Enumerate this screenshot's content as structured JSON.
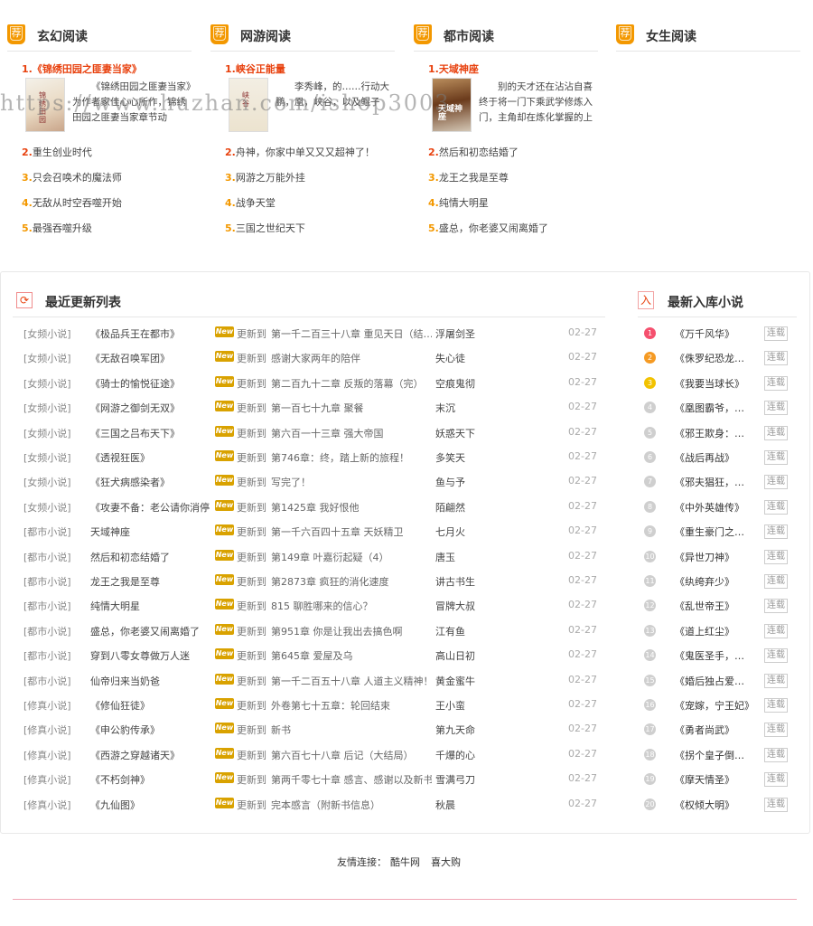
{
  "watermark": "https://www.huzhan.com/ishop3003",
  "categories": [
    {
      "title": "玄幻阅读",
      "badge": "荐",
      "top": {
        "rank": "1.",
        "title": "《锦绣田园之匪妻当家》",
        "cover_text": "锦绣田园",
        "desc": "《锦绣田园之匪妻当家》为作者家佳心心所作，锦绣田园之匪妻当家章节动"
      },
      "items": [
        {
          "rank": "2.",
          "title": "重生创业时代"
        },
        {
          "rank": "3.",
          "title": "只会召唤术的魔法师"
        },
        {
          "rank": "4.",
          "title": "无敌从时空吞噬开始"
        },
        {
          "rank": "5.",
          "title": "最强吞噬升级"
        }
      ]
    },
    {
      "title": "网游阅读",
      "badge": "荐",
      "top": {
        "rank": "1.",
        "title": "峡谷正能量",
        "cover_text": "峡谷",
        "desc": "李秀峰，的……行动大鹏，凰，峡谷，以及鲲子"
      },
      "items": [
        {
          "rank": "2.",
          "title": "舟神，你家中单又又又超神了！"
        },
        {
          "rank": "3.",
          "title": "网游之万能外挂"
        },
        {
          "rank": "4.",
          "title": "战争天堂"
        },
        {
          "rank": "5.",
          "title": "三国之世纪天下"
        }
      ]
    },
    {
      "title": "都市阅读",
      "badge": "荐",
      "top": {
        "rank": "1.",
        "title": "天域神座",
        "cover_text": "天域神座",
        "desc": "别的天才还在沾沾自喜终于将一门下乘武学修炼入门，主角却在炼化掌握的上"
      },
      "items": [
        {
          "rank": "2.",
          "title": "然后和初恋结婚了"
        },
        {
          "rank": "3.",
          "title": "龙王之我是至尊"
        },
        {
          "rank": "4.",
          "title": "纯情大明星"
        },
        {
          "rank": "5.",
          "title": "盛总，你老婆又闹离婚了"
        }
      ]
    },
    {
      "title": "女生阅读",
      "badge": "荐",
      "items": []
    }
  ],
  "updates": {
    "title": "最近更新列表",
    "new_label": "New",
    "update_label": "更新到",
    "rows": [
      {
        "category": "[女频小说]",
        "book": "《极品兵王在都市》",
        "chapter": "第一千二百三十八章 重见天日（结…",
        "author": "浮屠剑圣",
        "date": "02-27"
      },
      {
        "category": "[女频小说]",
        "book": "《无敌召唤军团》",
        "chapter": "感谢大家两年的陪伴",
        "author": "失心徒",
        "date": "02-27"
      },
      {
        "category": "[女频小说]",
        "book": "《骑士的愉悦征途》",
        "chapter": "第二百九十二章 反叛的落幕（完）",
        "author": "空痕鬼彻",
        "date": "02-27"
      },
      {
        "category": "[女频小说]",
        "book": "《网游之御剑无双》",
        "chapter": "第一百七十九章 聚餐",
        "author": "末沉",
        "date": "02-27"
      },
      {
        "category": "[女频小说]",
        "book": "《三国之吕布天下》",
        "chapter": "第六百一十三章 强大帝国",
        "author": "妖惑天下",
        "date": "02-27"
      },
      {
        "category": "[女频小说]",
        "book": "《透视狂医》",
        "chapter": "第746章：终，踏上新的旅程！",
        "author": "多笑天",
        "date": "02-27"
      },
      {
        "category": "[女频小说]",
        "book": "《狂犬病感染者》",
        "chapter": "写完了！",
        "author": "鱼与予",
        "date": "02-27"
      },
      {
        "category": "[女频小说]",
        "book": "《攻妻不备：老公请你消停",
        "chapter": "第1425章 我好恨他",
        "author": "陌翩然",
        "date": "02-27"
      },
      {
        "category": "[都市小说]",
        "book": "天域神座",
        "chapter": "第一千六百四十五章 天妖精卫",
        "author": "七月火",
        "date": "02-27"
      },
      {
        "category": "[都市小说]",
        "book": "然后和初恋结婚了",
        "chapter": "第149章 叶嘉衍起疑（4）",
        "author": "唐玉",
        "date": "02-27"
      },
      {
        "category": "[都市小说]",
        "book": "龙王之我是至尊",
        "chapter": "第2873章 疯狂的消化速度",
        "author": "讲古书生",
        "date": "02-27"
      },
      {
        "category": "[都市小说]",
        "book": "纯情大明星",
        "chapter": "815 聊胜哪来的信心？",
        "author": "冒牌大叔",
        "date": "02-27"
      },
      {
        "category": "[都市小说]",
        "book": "盛总，你老婆又闹离婚了",
        "chapter": "第951章 你是让我出去搞色啊",
        "author": "江有鱼",
        "date": "02-27"
      },
      {
        "category": "[都市小说]",
        "book": "穿到八零女尊做万人迷",
        "chapter": "第645章 爱屋及乌",
        "author": "高山日初",
        "date": "02-27"
      },
      {
        "category": "[都市小说]",
        "book": "仙帝归来当奶爸",
        "chapter": "第一千二百五十八章 人道主义精神！",
        "author": "黄金蜜牛",
        "date": "02-27"
      },
      {
        "category": "[修真小说]",
        "book": "《修仙狂徒》",
        "chapter": "外卷第七十五章：轮回结束",
        "author": "王小蛮",
        "date": "02-27"
      },
      {
        "category": "[修真小说]",
        "book": "《申公豹传承》",
        "chapter": "新书",
        "author": "第九天命",
        "date": "02-27"
      },
      {
        "category": "[修真小说]",
        "book": "《西游之穿越诸天》",
        "chapter": "第六百七十八章 后记（大结局）",
        "author": "千爆的心",
        "date": "02-27"
      },
      {
        "category": "[修真小说]",
        "book": "《不朽剑神》",
        "chapter": "第两千零七十章 感言、感谢以及新书",
        "author": "雪满弓刀",
        "date": "02-27"
      },
      {
        "category": "[修真小说]",
        "book": "《九仙图》",
        "chapter": "完本感言（附新书信息）",
        "author": "秋晨",
        "date": "02-27"
      }
    ]
  },
  "new_novels": {
    "title": "最新入库小说",
    "status_label": "连载",
    "items": [
      {
        "rank": "1",
        "title": "《万千风华》"
      },
      {
        "rank": "2",
        "title": "《侏罗纪恐龙…"
      },
      {
        "rank": "3",
        "title": "《我要当球长》"
      },
      {
        "rank": "4",
        "title": "《凰图霸爷，…"
      },
      {
        "rank": "5",
        "title": "《邪王欺身：…"
      },
      {
        "rank": "6",
        "title": "《战后再战》"
      },
      {
        "rank": "7",
        "title": "《邪夫猖狂，…"
      },
      {
        "rank": "8",
        "title": "《中外英雄传》"
      },
      {
        "rank": "9",
        "title": "《重生豪门之…"
      },
      {
        "rank": "10",
        "title": "《异世刀神》"
      },
      {
        "rank": "11",
        "title": "《纨绔弃少》"
      },
      {
        "rank": "12",
        "title": "《乱世帝王》"
      },
      {
        "rank": "13",
        "title": "《道上红尘》"
      },
      {
        "rank": "14",
        "title": "《鬼医圣手，…"
      },
      {
        "rank": "15",
        "title": "《婚后独占爱…"
      },
      {
        "rank": "16",
        "title": "《宠嫁，宁王妃》"
      },
      {
        "rank": "17",
        "title": "《勇者尚武》"
      },
      {
        "rank": "18",
        "title": "《拐个皇子倒…"
      },
      {
        "rank": "19",
        "title": "《摩天情圣》"
      },
      {
        "rank": "20",
        "title": "《权倾大明》"
      }
    ]
  },
  "footer": {
    "friends_label": "友情连接：",
    "links": [
      "酷牛网",
      "喜大购"
    ]
  },
  "colors": {
    "accent_orange": "#f39800",
    "accent_red": "#e8410e",
    "new_badge": "#d9a200",
    "rank1": "#f5506e",
    "rank2": "#f59a23",
    "rank3": "#f2c200",
    "footer_line": "#f0a6b4"
  }
}
